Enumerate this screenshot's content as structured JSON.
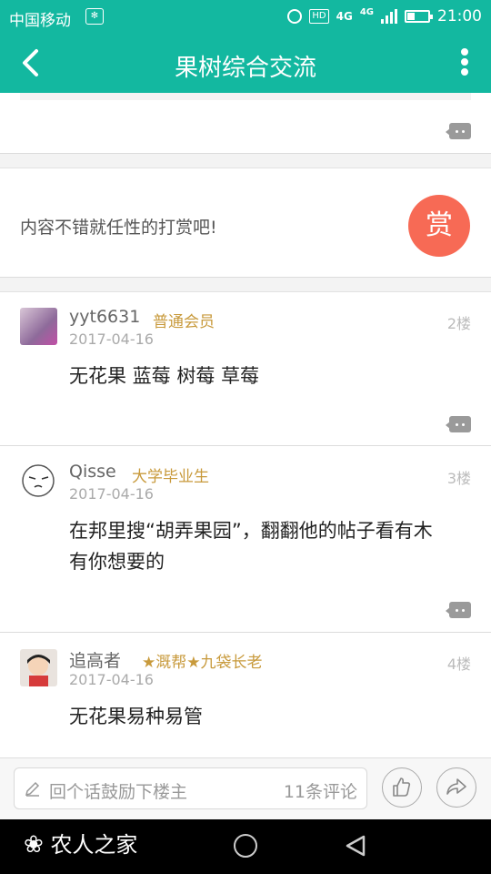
{
  "status_bar": {
    "carrier": "中国移动",
    "network_hd": "HD",
    "network_4g_1": "4G",
    "network_4g_2": "4G",
    "time": "21:00",
    "battery_level": 0.35
  },
  "title_bar": {
    "title": "果树综合交流",
    "back_icon": "back-arrow-icon",
    "more_icon": "more-vertical-icon"
  },
  "reward": {
    "text": "内容不错就任性的打赏吧!",
    "button_label": "赏"
  },
  "replies": [
    {
      "username": "yyt6631",
      "badge": "普通会员",
      "date": "2017-04-16",
      "floor": "2楼",
      "content": "无花果 蓝莓 树莓 草莓"
    },
    {
      "username": "Qisse",
      "badge": "大学毕业生",
      "date": "2017-04-16",
      "floor": "3楼",
      "content": "在邦里搜“胡弄果园”，翻翻他的帖子看有木有你想要的"
    },
    {
      "username": "追高者",
      "badge": "★溉帮★九袋长老",
      "date": "2017-04-16",
      "floor": "4楼",
      "content": "无花果易种易管"
    }
  ],
  "bottom_bar": {
    "reply_placeholder": "回个话鼓励下楼主",
    "comment_count": "11条评论",
    "like_icon": "thumbs-up-icon",
    "share_icon": "share-icon"
  },
  "nav_bar": {
    "watermark": "农人之家"
  },
  "colors": {
    "accent": "#13b8a0",
    "reward": "#f76a55",
    "badge": "#c89a3c"
  }
}
